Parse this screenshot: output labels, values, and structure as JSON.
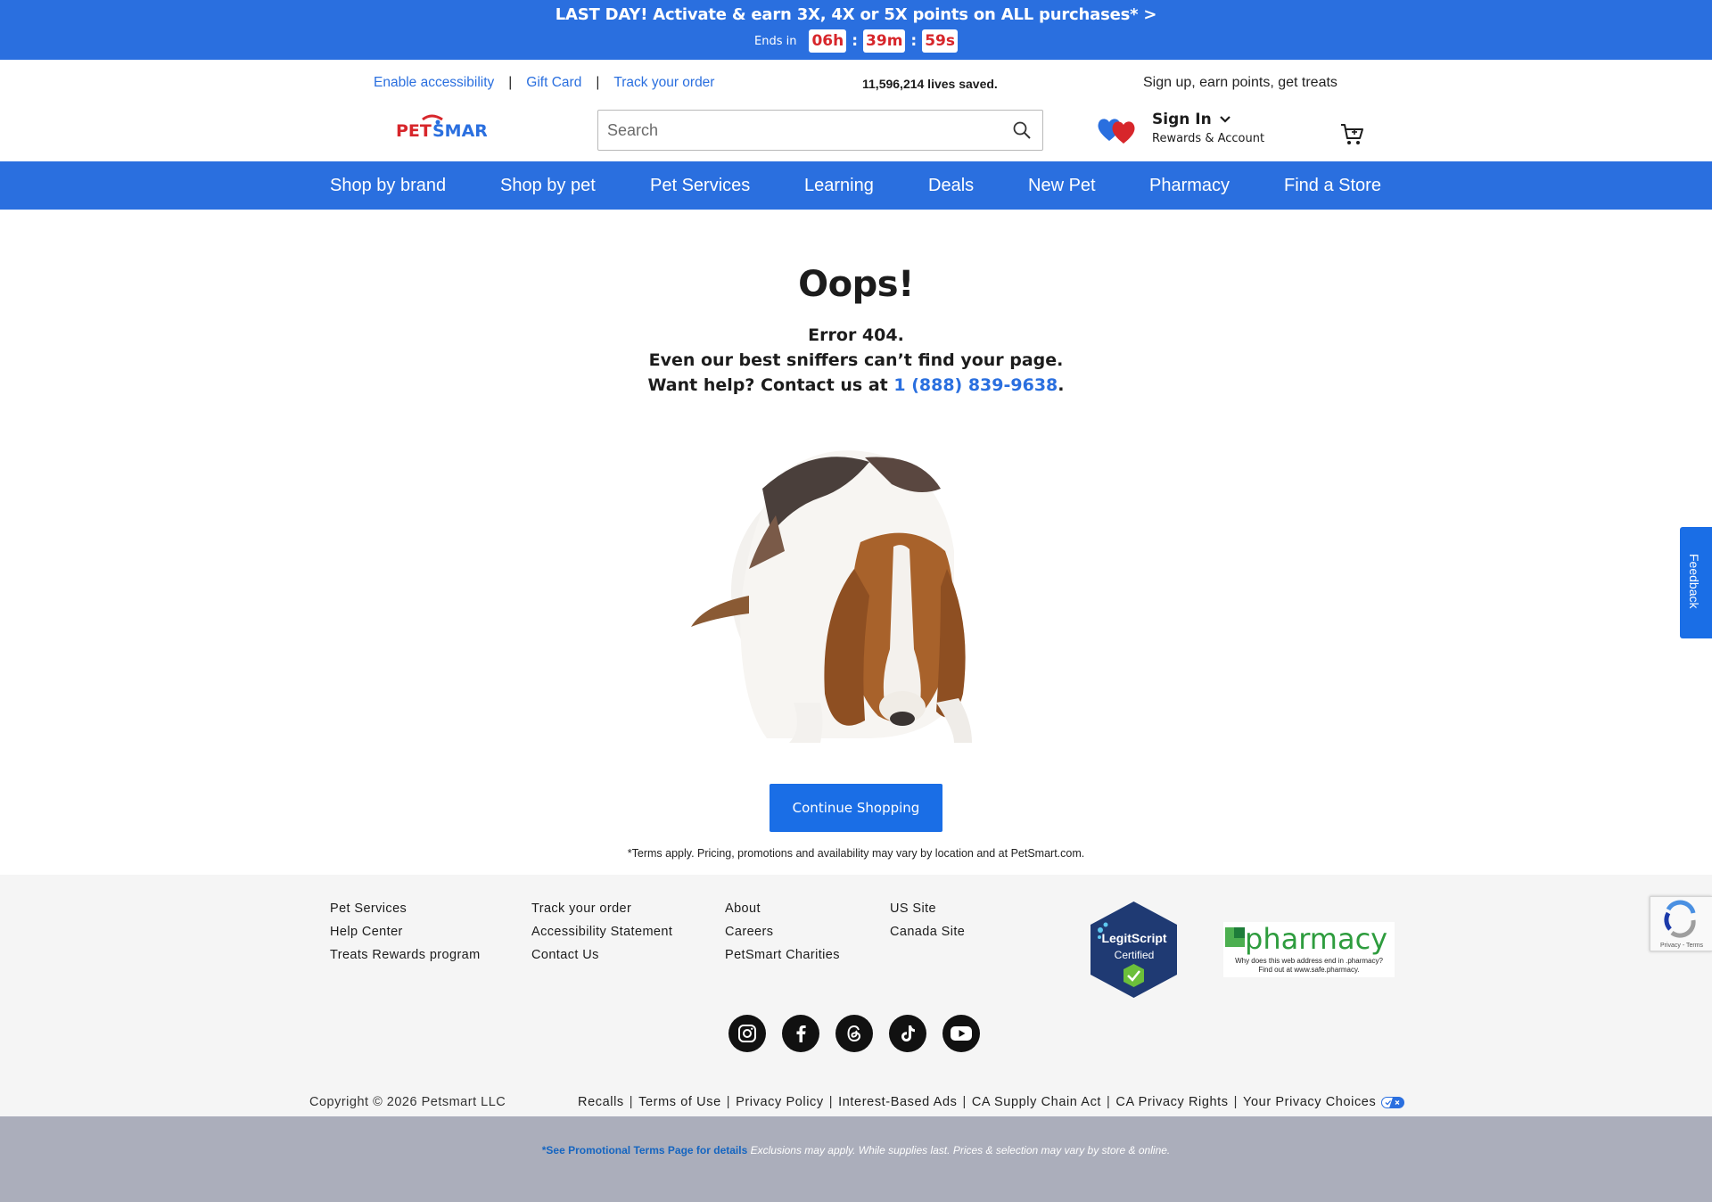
{
  "promo": {
    "title": "LAST DAY! Activate & earn 3X, 4X or 5X points on ALL purchases* >",
    "ends_in": "Ends in",
    "hours": "06h",
    "minutes": "39m",
    "seconds": "59s",
    "separator": ":"
  },
  "utility": {
    "accessibility": "Enable accessibility",
    "gift_card": "Gift Card",
    "track_order": "Track your order",
    "separator": "|",
    "lives_saved": "11,596,214 lives saved.",
    "signup": "Sign up, earn points, get treats"
  },
  "header": {
    "logo_text": "PETSMART",
    "search_placeholder": "Search",
    "signin_title": "Sign In",
    "signin_sub": "Rewards & Account"
  },
  "nav": {
    "items": [
      "Shop by brand",
      "Shop by pet",
      "Pet Services",
      "Learning",
      "Deals",
      "New Pet",
      "Pharmacy",
      "Find a Store"
    ]
  },
  "main": {
    "title": "Oops!",
    "line1": "Error 404.",
    "line2": "Even our best sniffers can’t find your page.",
    "line3_prefix": "Want help? Contact us at ",
    "phone": "1 (888) 839-9638",
    "line3_suffix": ".",
    "cta": "Continue Shopping",
    "terms": "*Terms apply. Pricing, promotions and availability may vary by location and at PetSmart.com."
  },
  "footer": {
    "col1": [
      "Pet Services",
      "Help Center",
      "Treats Rewards program"
    ],
    "col2": [
      "Track your order",
      "Accessibility Statement",
      "Contact Us"
    ],
    "col3": [
      "About",
      "Careers",
      "PetSmart Charities"
    ],
    "col4": [
      "US Site",
      "Canada Site"
    ],
    "legitscript": {
      "line1": "LegitScript",
      "line2": "Certified"
    },
    "pharmacy_badge": {
      "word": "pharmacy",
      "line1": "Why does this web address end in .pharmacy?",
      "line2": "Find out at www.safe.pharmacy."
    },
    "copyright": "Copyright © 2026 Petsmart LLC",
    "legal": [
      "Recalls",
      "Terms of Use",
      "Privacy Policy",
      "Interest-Based Ads",
      "CA Supply Chain Act",
      "CA Privacy Rights",
      "Your Privacy Choices"
    ],
    "legal_separator": "|",
    "social": [
      "instagram-icon",
      "facebook-icon",
      "threads-icon",
      "tiktok-icon",
      "youtube-icon"
    ]
  },
  "bottom": {
    "see": "*See Promotional Terms Page for details",
    "exclusions": "Exclusions may apply. While supplies last. Prices & selection may vary by store & online."
  },
  "widgets": {
    "feedback": "Feedback",
    "recaptcha": "Privacy - Terms"
  },
  "colors": {
    "brand_blue": "#2a6fdf",
    "countdown_red": "#d7262b",
    "footer_bg": "#f5f5f5",
    "bottom_bg": "#abaebb"
  }
}
